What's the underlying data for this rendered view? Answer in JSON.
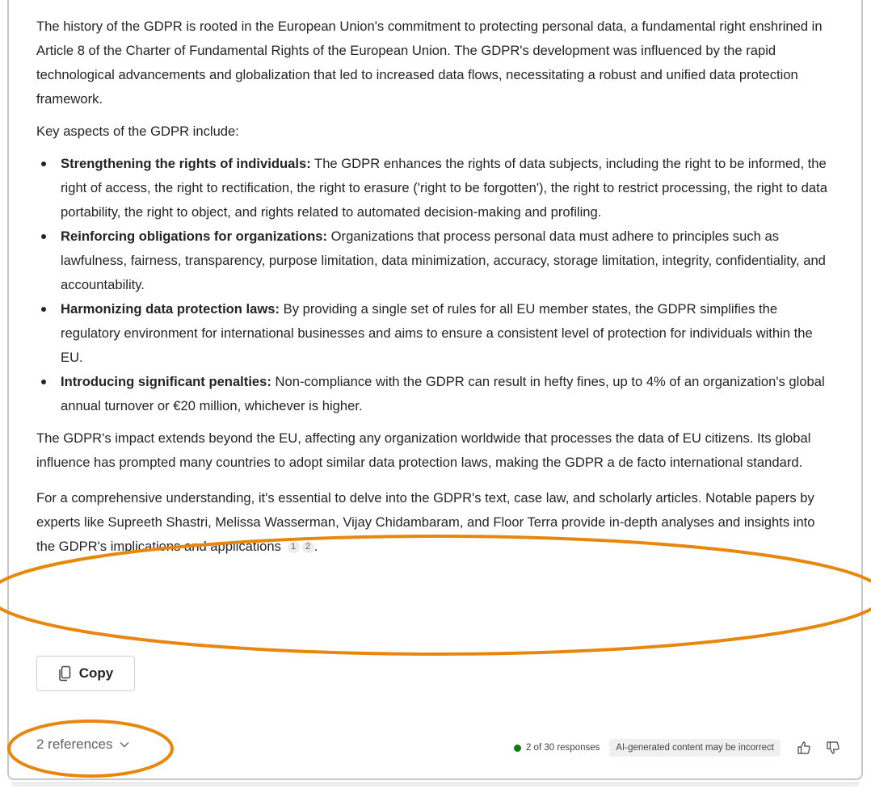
{
  "message": {
    "para1": "The history of the GDPR is rooted in the European Union's commitment to protecting personal data, a fundamental right enshrined in Article 8 of the Charter of Fundamental Rights of the European Union. The GDPR's development was influenced by the rapid technological advancements and globalization that led to increased data flows, necessitating a robust and unified data protection framework.",
    "para2": "Key aspects of the GDPR include:",
    "bullets": [
      {
        "title": "Strengthening the rights of individuals:",
        "text": " The GDPR enhances the rights of data subjects, including the right to be informed, the right of access, the right to rectification, the right to erasure ('right to be forgotten'), the right to restrict processing, the right to data portability, the right to object, and rights related to automated decision-making and profiling."
      },
      {
        "title": "Reinforcing obligations for organizations:",
        "text": " Organizations that process personal data must adhere to principles such as lawfulness, fairness, transparency, purpose limitation, data minimization, accuracy, storage limitation, integrity, confidentiality, and accountability."
      },
      {
        "title": "Harmonizing data protection laws:",
        "text": " By providing a single set of rules for all EU member states, the GDPR simplifies the regulatory environment for international businesses and aims to ensure a consistent level of protection for individuals within the EU."
      },
      {
        "title": "Introducing significant penalties:",
        "text": " Non-compliance with the GDPR can result in hefty fines, up to 4% of an organization's global annual turnover or €20 million, whichever is higher."
      }
    ],
    "para3": "The GDPR's impact extends beyond the EU, affecting any organization worldwide that processes the data of EU citizens. Its global influence has prompted many countries to adopt similar data protection laws, making the GDPR a de facto international standard.",
    "para4": "For a comprehensive understanding, it's essential to delve into the GDPR's text, case law, and scholarly articles. Notable papers by experts like Supreeth Shastri, Melissa Wasserman, Vijay Chidambaram, and Floor Terra provide in-depth analyses and insights into the GDPR's implications and applications",
    "citations": [
      "1",
      "2"
    ],
    "para4_end": "."
  },
  "actions": {
    "copy_label": "Copy",
    "copy_icon": "copy-icon"
  },
  "footer": {
    "references_label": "2 references",
    "responses_text": "2 of 30 responses",
    "disclaimer": "AI-generated content may be incorrect",
    "status_color": "#107c10"
  },
  "annotation_color": "#e8870e"
}
